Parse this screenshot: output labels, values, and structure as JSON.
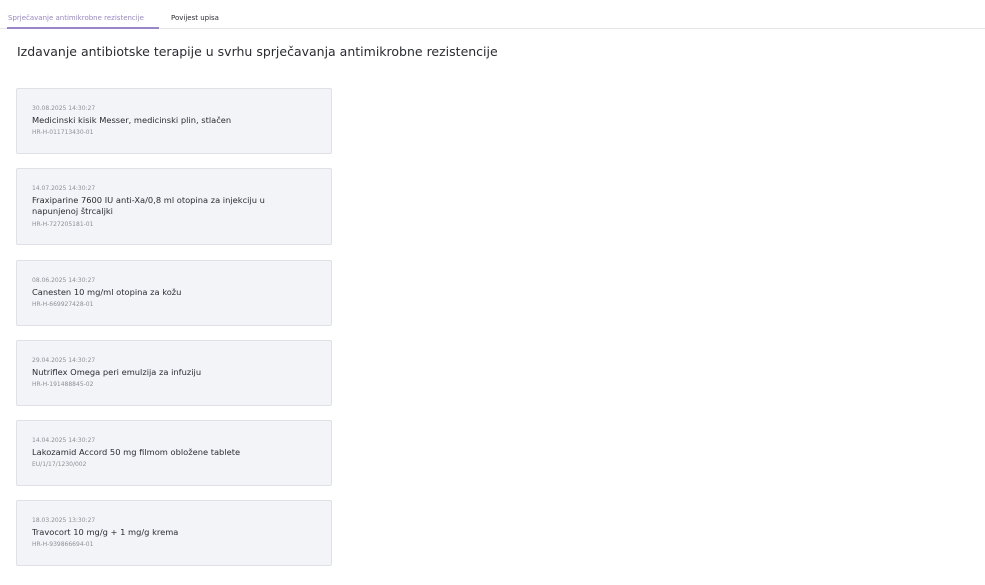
{
  "tabs": [
    {
      "label": "Sprječavanje antimikrobne rezistencije",
      "active": true
    },
    {
      "label": "Povijest upisa",
      "active": false
    }
  ],
  "page_title": "Izdavanje antibiotske terapije u svrhu sprječavanja antimikrobne rezistencije",
  "accent_color": "#9a87c8",
  "prescriptions": [
    {
      "date": "30.08.2025 14:30:27",
      "name": "Medicinski kisik Messer, medicinski plin, stlačen",
      "code": "HR-H-011713430-01"
    },
    {
      "date": "14.07.2025 14:30:27",
      "name": "Fraxiparine 7600 IU anti-Xa/0,8 ml otopina za injekciju u napunjenoj štrcaljki",
      "code": "HR-H-727205181-01"
    },
    {
      "date": "08.06.2025 14:30:27",
      "name": "Canesten 10 mg/ml otopina za kožu",
      "code": "HR-H-669927428-01"
    },
    {
      "date": "29.04.2025 14:30:27",
      "name": "Nutriflex Omega peri emulzija za infuziju",
      "code": "HR-H-191488845-02"
    },
    {
      "date": "14.04.2025 14:30:27",
      "name": "Lakozamid Accord 50 mg filmom obložene tablete",
      "code": "EU/1/17/1230/002"
    },
    {
      "date": "18.03.2025 13:30:27",
      "name": "Travocort 10 mg/g + 1 mg/g krema",
      "code": "HR-H-939866694-01"
    }
  ]
}
